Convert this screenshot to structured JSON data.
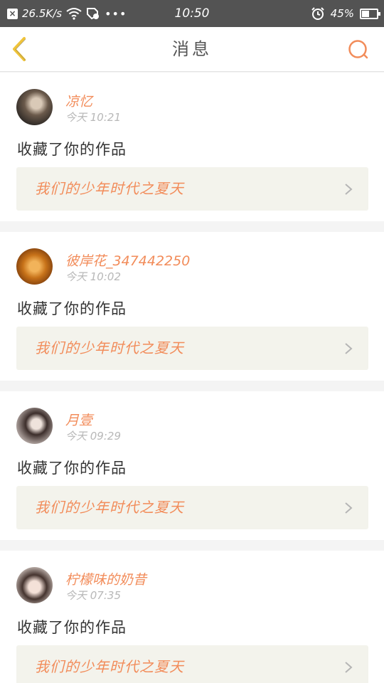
{
  "status_bar": {
    "notification_icon": "close-box-icon",
    "network_speed": "26.5K/s",
    "icons": [
      "wifi-icon",
      "sim-icon",
      "more-dots-icon",
      "alarm-icon",
      "battery-icon"
    ],
    "dots": "•••",
    "time": "10:50",
    "battery_percent": "45%",
    "battery_level": 0.45
  },
  "header": {
    "title": "消息",
    "back_icon": "chevron-left-icon",
    "search_icon": "search-icon"
  },
  "colors": {
    "accent": "#f28c5a",
    "back_arrow": "#f0c43a",
    "status_bar_bg": "#535353",
    "link_bg": "#f3f3ec"
  },
  "messages": [
    {
      "username": "凉忆",
      "time": "今天 10:21",
      "action": "收藏了你的作品",
      "work_title": "我们的少年时代之夏天"
    },
    {
      "username": "彼岸花_347442250",
      "time": "今天 10:02",
      "action": "收藏了你的作品",
      "work_title": "我们的少年时代之夏天"
    },
    {
      "username": "月壹",
      "time": "今天 09:29",
      "action": "收藏了你的作品",
      "work_title": "我们的少年时代之夏天"
    },
    {
      "username": "柠檬味的奶昔",
      "time": "今天 07:35",
      "action": "收藏了你的作品",
      "work_title": "我们的少年时代之夏天"
    }
  ]
}
